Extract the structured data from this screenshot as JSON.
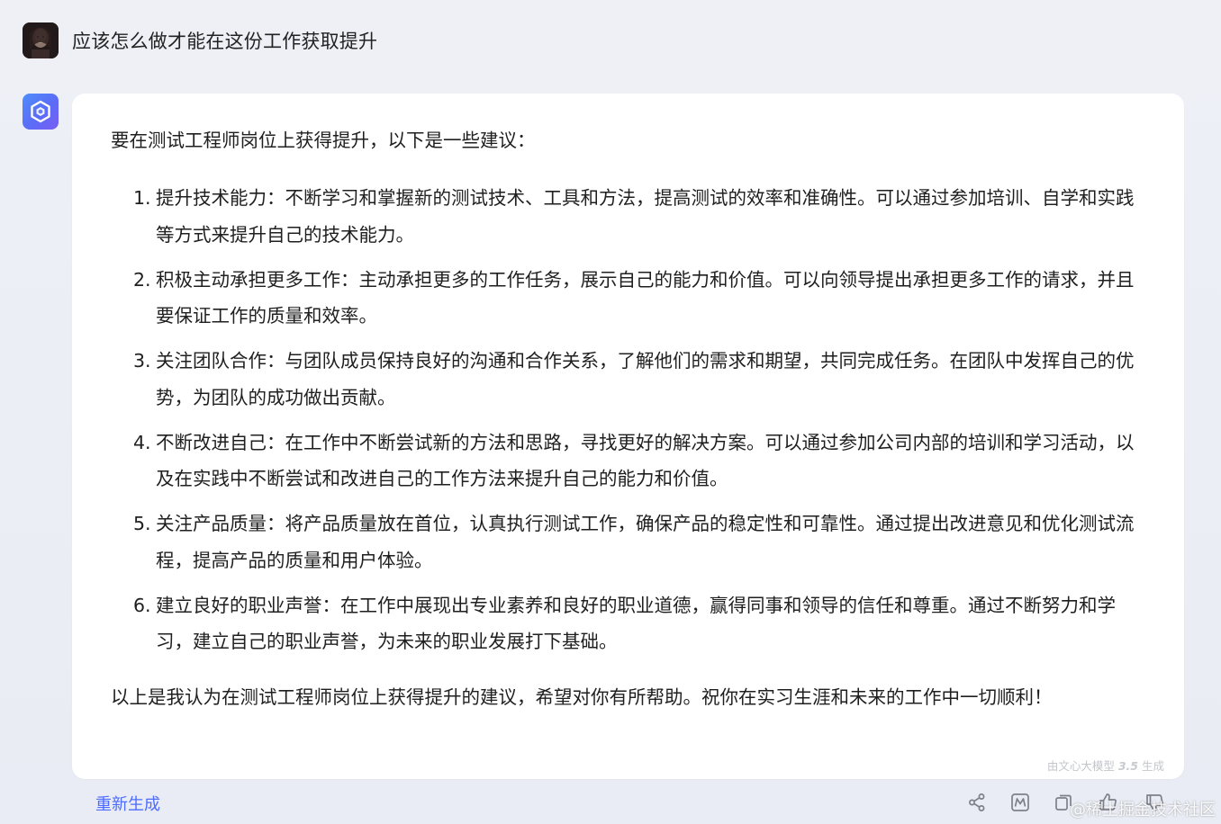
{
  "user": {
    "question": "应该怎么做才能在这份工作获取提升",
    "avatar_icon": "user-avatar-photo"
  },
  "bot": {
    "avatar_icon": "ernie-bot-logo-icon"
  },
  "answer": {
    "intro": "要在测试工程师岗位上获得提升，以下是一些建议：",
    "items": [
      {
        "num": "1.",
        "text": "提升技术能力：不断学习和掌握新的测试技术、工具和方法，提高测试的效率和准确性。可以通过参加培训、自学和实践等方式来提升自己的技术能力。"
      },
      {
        "num": "2.",
        "text": "积极主动承担更多工作：主动承担更多的工作任务，展示自己的能力和价值。可以向领导提出承担更多工作的请求，并且要保证工作的质量和效率。"
      },
      {
        "num": "3.",
        "text": "关注团队合作：与团队成员保持良好的沟通和合作关系，了解他们的需求和期望，共同完成任务。在团队中发挥自己的优势，为团队的成功做出贡献。"
      },
      {
        "num": "4.",
        "text": "不断改进自己：在工作中不断尝试新的方法和思路，寻找更好的解决方案。可以通过参加公司内部的培训和学习活动，以及在实践中不断尝试和改进自己的工作方法来提升自己的能力和价值。"
      },
      {
        "num": "5.",
        "text": "关注产品质量：将产品质量放在首位，认真执行测试工作，确保产品的稳定性和可靠性。通过提出改进意见和优化测试流程，提高产品的质量和用户体验。"
      },
      {
        "num": "6.",
        "text": "建立良好的职业声誉：在工作中展现出专业素养和良好的职业道德，赢得同事和领导的信任和尊重。通过不断努力和学习，建立自己的职业声誉，为未来的职业发展打下基础。"
      }
    ],
    "outro": "以上是我认为在测试工程师岗位上获得提升的建议，希望对你有所帮助。祝你在实习生涯和未来的工作中一切顺利！",
    "model_note_prefix": "由文心大模型",
    "model_note_version": "3.5",
    "model_note_suffix": "生成"
  },
  "actions": {
    "regenerate_label": "重新生成",
    "icons": [
      "share-icon",
      "mindmap-icon",
      "copy-icon",
      "thumbs-up-icon",
      "thumbs-down-icon"
    ]
  },
  "watermark": "@稀土掘金技术社区",
  "colors": {
    "accent": "#4d6bfe",
    "page_background": "#eef0f6",
    "card_background": "#ffffff",
    "icon_gray": "#7d8089"
  }
}
